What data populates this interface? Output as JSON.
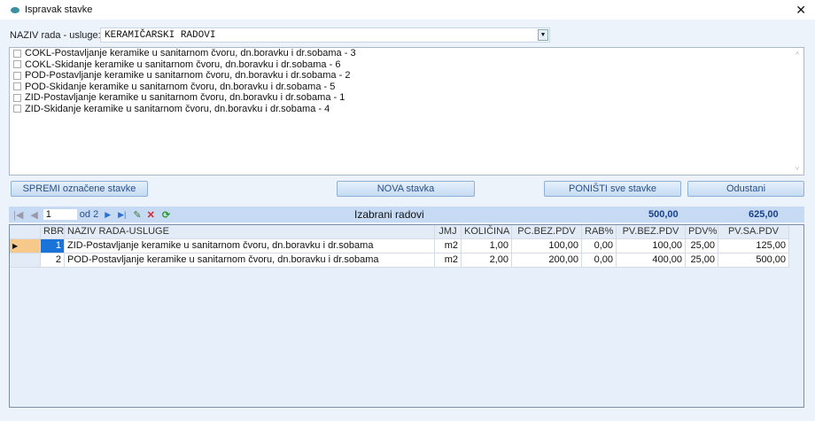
{
  "window": {
    "title": "Ispravak stavke",
    "close": "✕"
  },
  "naziv": {
    "label": "NAZIV rada - usluge:",
    "value": "KERAMIČARSKI RADOVI"
  },
  "items": [
    "COKL-Postavljanje keramike u sanitarnom čvoru, dn.boravku i dr.sobama -  3",
    "COKL-Skidanje keramike u sanitarnom čvoru, dn.boravku i dr.sobama -  6",
    "POD-Postavljanje keramike u sanitarnom čvoru, dn.boravku i dr.sobama -  2",
    "POD-Skidanje keramike u sanitarnom čvoru, dn.boravku i dr.sobama -  5",
    "ZID-Postavljanje keramike u sanitarnom čvoru, dn.boravku i dr.sobama -  1",
    "ZID-Skidanje keramike u sanitarnom čvoru, dn.boravku i dr.sobama -  4"
  ],
  "buttons": {
    "save": "SPREMI označene stavke",
    "new": "NOVA stavka",
    "reset": "PONIŠTI sve stavke",
    "cancel": "Odustani"
  },
  "nav": {
    "page": "1",
    "of": "od 2",
    "title": "Izabrani radovi",
    "total_bez": "500,00",
    "total_sa": "625,00"
  },
  "grid": {
    "headers": [
      "RBR",
      "NAZIV RADA-USLUGE",
      "JMJ",
      "KOLIČINA",
      "PC.BEZ.PDV",
      "RAB%",
      "PV.BEZ.PDV",
      "PDV%",
      "PV.SA.PDV"
    ],
    "rows": [
      [
        "1",
        "ZID-Postavljanje keramike u sanitarnom čvoru, dn.boravku i dr.sobama",
        "m2",
        "1,00",
        "100,00",
        "0,00",
        "100,00",
        "25,00",
        "125,00"
      ],
      [
        "2",
        "POD-Postavljanje keramike u sanitarnom čvoru, dn.boravku i dr.sobama",
        "m2",
        "2,00",
        "200,00",
        "0,00",
        "400,00",
        "25,00",
        "500,00"
      ]
    ]
  }
}
